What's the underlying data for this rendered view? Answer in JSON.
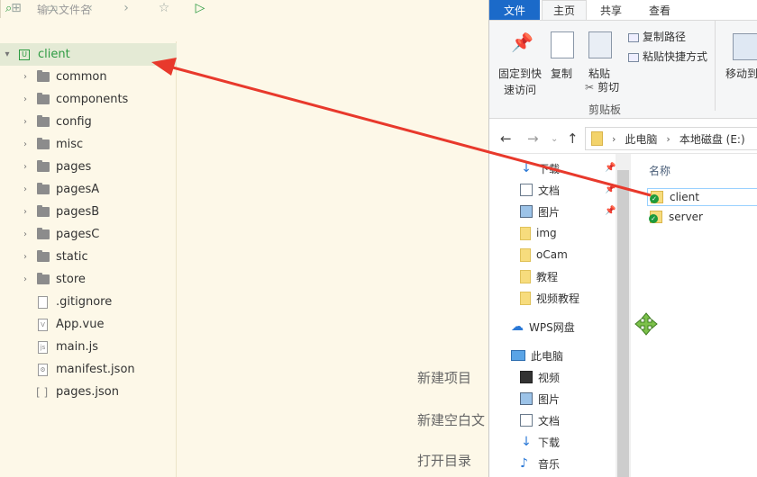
{
  "editor": {
    "search_placeholder": "输入文件名",
    "toolbar_icons": [
      "new-file-icon",
      "save-icon",
      "back-icon",
      "forward-icon",
      "star-icon",
      "run-icon",
      "search-icon"
    ],
    "tree": {
      "root": "client",
      "items": [
        {
          "type": "folder",
          "label": "common"
        },
        {
          "type": "folder",
          "label": "components"
        },
        {
          "type": "folder",
          "label": "config"
        },
        {
          "type": "folder",
          "label": "misc"
        },
        {
          "type": "folder",
          "label": "pages"
        },
        {
          "type": "folder",
          "label": "pagesA"
        },
        {
          "type": "folder",
          "label": "pagesB"
        },
        {
          "type": "folder",
          "label": "pagesC"
        },
        {
          "type": "folder",
          "label": "static"
        },
        {
          "type": "folder",
          "label": "store"
        },
        {
          "type": "file",
          "label": ".gitignore"
        },
        {
          "type": "file",
          "label": "App.vue"
        },
        {
          "type": "file",
          "label": "main.js"
        },
        {
          "type": "file",
          "label": "manifest.json"
        },
        {
          "type": "file",
          "label": "pages.json"
        }
      ]
    },
    "center_links": [
      "新建项目",
      "新建空白文",
      "打开目录"
    ]
  },
  "explorer": {
    "tabs": [
      "文件",
      "主页",
      "共享",
      "查看"
    ],
    "ribbon": {
      "pin_label_1": "固定到快",
      "pin_label_2": "速访问",
      "copy": "复制",
      "paste": "粘贴",
      "copy_path": "复制路径",
      "paste_shortcut": "粘贴快捷方式",
      "cut": "剪切",
      "move_to": "移动到",
      "group_clipboard": "剪贴板"
    },
    "address": {
      "crumbs": [
        "此电脑",
        "本地磁盘 (E:)"
      ]
    },
    "nav_pane": [
      {
        "label": "下载",
        "icon": "download-icon",
        "pinned": true
      },
      {
        "label": "文档",
        "icon": "document-icon",
        "pinned": true
      },
      {
        "label": "图片",
        "icon": "picture-icon",
        "pinned": true
      },
      {
        "label": "img",
        "icon": "folder-icon",
        "pinned": false
      },
      {
        "label": "oCam",
        "icon": "folder-icon",
        "pinned": false
      },
      {
        "label": "教程",
        "icon": "folder-icon",
        "pinned": false
      },
      {
        "label": "视频教程",
        "icon": "folder-icon",
        "pinned": false
      },
      {
        "label": "WPS网盘",
        "icon": "cloud-icon",
        "pinned": false
      },
      {
        "label": "此电脑",
        "icon": "computer-icon",
        "pinned": false
      },
      {
        "label": "视频",
        "icon": "video-icon",
        "pinned": false
      },
      {
        "label": "图片",
        "icon": "picture-icon",
        "pinned": false
      },
      {
        "label": "文档",
        "icon": "document-icon",
        "pinned": false
      },
      {
        "label": "下载",
        "icon": "download-icon",
        "pinned": false
      },
      {
        "label": "音乐",
        "icon": "music-icon",
        "pinned": false
      }
    ],
    "column_name": "名称",
    "files": [
      {
        "label": "client",
        "selected": true
      },
      {
        "label": "server",
        "selected": false
      }
    ]
  },
  "colors": {
    "accent_green": "#2d9b42",
    "arrow_red": "#e8392c",
    "file_tab_blue": "#1b6ac9"
  }
}
